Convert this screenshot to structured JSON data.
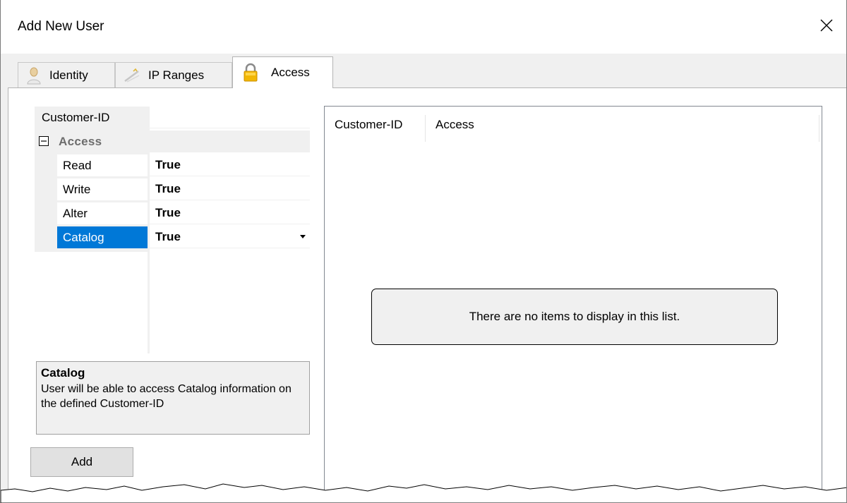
{
  "window": {
    "title": "Add New User",
    "close_glyph": "×"
  },
  "tabs": [
    {
      "label": "Identity",
      "icon": "user-icon",
      "active": false
    },
    {
      "label": "IP Ranges",
      "icon": "network-icon",
      "active": false
    },
    {
      "label": "Access",
      "icon": "lock-icon",
      "active": true
    }
  ],
  "property_grid": {
    "rows": [
      {
        "name": "Customer-ID",
        "value": ""
      },
      {
        "name": "Access",
        "value": "",
        "category": true,
        "expander": "⊟"
      },
      {
        "name": "Read",
        "value": "True"
      },
      {
        "name": "Write",
        "value": "True"
      },
      {
        "name": "Alter",
        "value": "True"
      },
      {
        "name": "Catalog",
        "value": "True",
        "selected": true
      }
    ]
  },
  "help": {
    "title": "Catalog",
    "description": "User will be able to access Catalog information on the defined Customer-ID"
  },
  "add_button": {
    "label": "Add"
  },
  "list_view": {
    "columns": [
      "Customer-ID",
      "Access"
    ],
    "empty_message": "There are no items to display in this list."
  },
  "colors": {
    "selection": "#0078d7",
    "face": "#f0f0f0",
    "category_text": "#6d6d6d"
  }
}
